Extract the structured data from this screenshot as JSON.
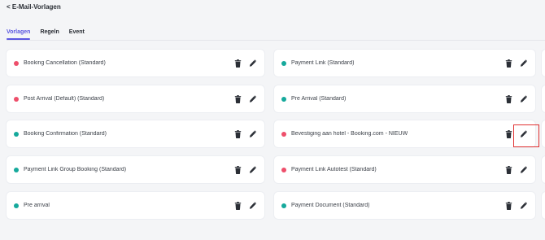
{
  "header": {
    "back_label": "< E-Mail-Vorlagen"
  },
  "tabs": [
    {
      "label": "Vorlagen",
      "active": true
    },
    {
      "label": "Regeln",
      "active": false
    },
    {
      "label": "Event",
      "active": false
    }
  ],
  "colors": {
    "status_red": "#ee4f6b",
    "status_teal": "#16a99c",
    "accent": "#5b57e0",
    "highlight_border": "#e03131"
  },
  "templates_left": [
    {
      "name": "Booking Cancellation (Standard)",
      "status": "red"
    },
    {
      "name": "Post Arrival (Default) (Standard)",
      "status": "red"
    },
    {
      "name": "Booking Confirmation (Standard)",
      "status": "teal"
    },
    {
      "name": "Payment Link Group Booking (Standard)",
      "status": "teal"
    },
    {
      "name": "Pre arrival",
      "status": "teal"
    }
  ],
  "templates_right": [
    {
      "name": "Payment Link (Standard)",
      "status": "teal"
    },
    {
      "name": "Pre Arrival (Standard)",
      "status": "teal"
    },
    {
      "name": "Bevestiging aan hotel - Booking.com - NIEUW",
      "status": "red"
    },
    {
      "name": "Payment Link Autotest (Standard)",
      "status": "red"
    },
    {
      "name": "Payment Document (Standard)",
      "status": "teal"
    }
  ],
  "icons": {
    "delete": "trash-icon",
    "edit": "pencil-icon"
  }
}
